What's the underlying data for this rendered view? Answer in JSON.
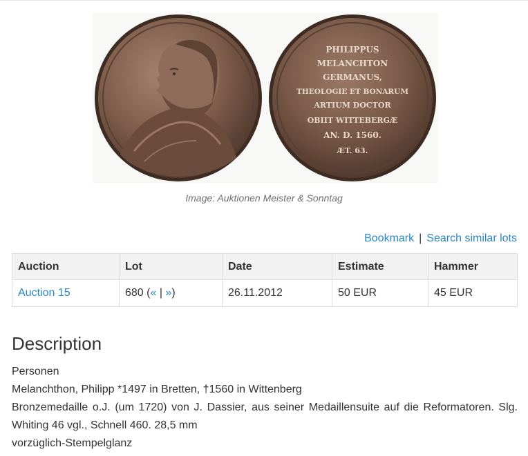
{
  "image": {
    "alt": "Bronze medal of Philipp Melanchthon, obverse and reverse",
    "reverse_inscription": [
      "PHILIPPUS",
      "MELANCHTON",
      "GERMANUS,",
      "THEOLOGIE ET BONARUM",
      "ARTIUM DOCTOR",
      "OBIIT WITTEBERGÆ",
      "AN. D. 1560.",
      "ÆT. 63."
    ],
    "credit": "Image: Auktionen Meister & Sonntag"
  },
  "actions": {
    "bookmark": "Bookmark",
    "separator": "|",
    "search_similar": "Search similar lots"
  },
  "table": {
    "headers": [
      "Auction",
      "Lot",
      "Date",
      "Estimate",
      "Hammer"
    ],
    "row": {
      "auction": "Auction 15",
      "lot_number": "680 (",
      "prev": "«",
      "lot_sep": " | ",
      "next": "»",
      "lot_close": ")",
      "date": "26.11.2012",
      "estimate": "50 EUR",
      "hammer": "45 EUR"
    }
  },
  "description": {
    "heading": "Description",
    "lines": [
      "Personen",
      "Melanchthon, Philipp *1497 in Bretten, †1560 in Wittenberg",
      "Bronzemedaille o.J. (um 1720) von J. Dassier, aus seiner Medaillensuite auf die Reformatoren. Slg. Whiting 46 vgl., Schnell 460. 28,5 mm",
      "vorzüglich-Stempelglanz"
    ]
  },
  "colors": {
    "link": "#2a87c5",
    "header_bg": "#f2f2f2",
    "bronze": "#7a5a48"
  }
}
